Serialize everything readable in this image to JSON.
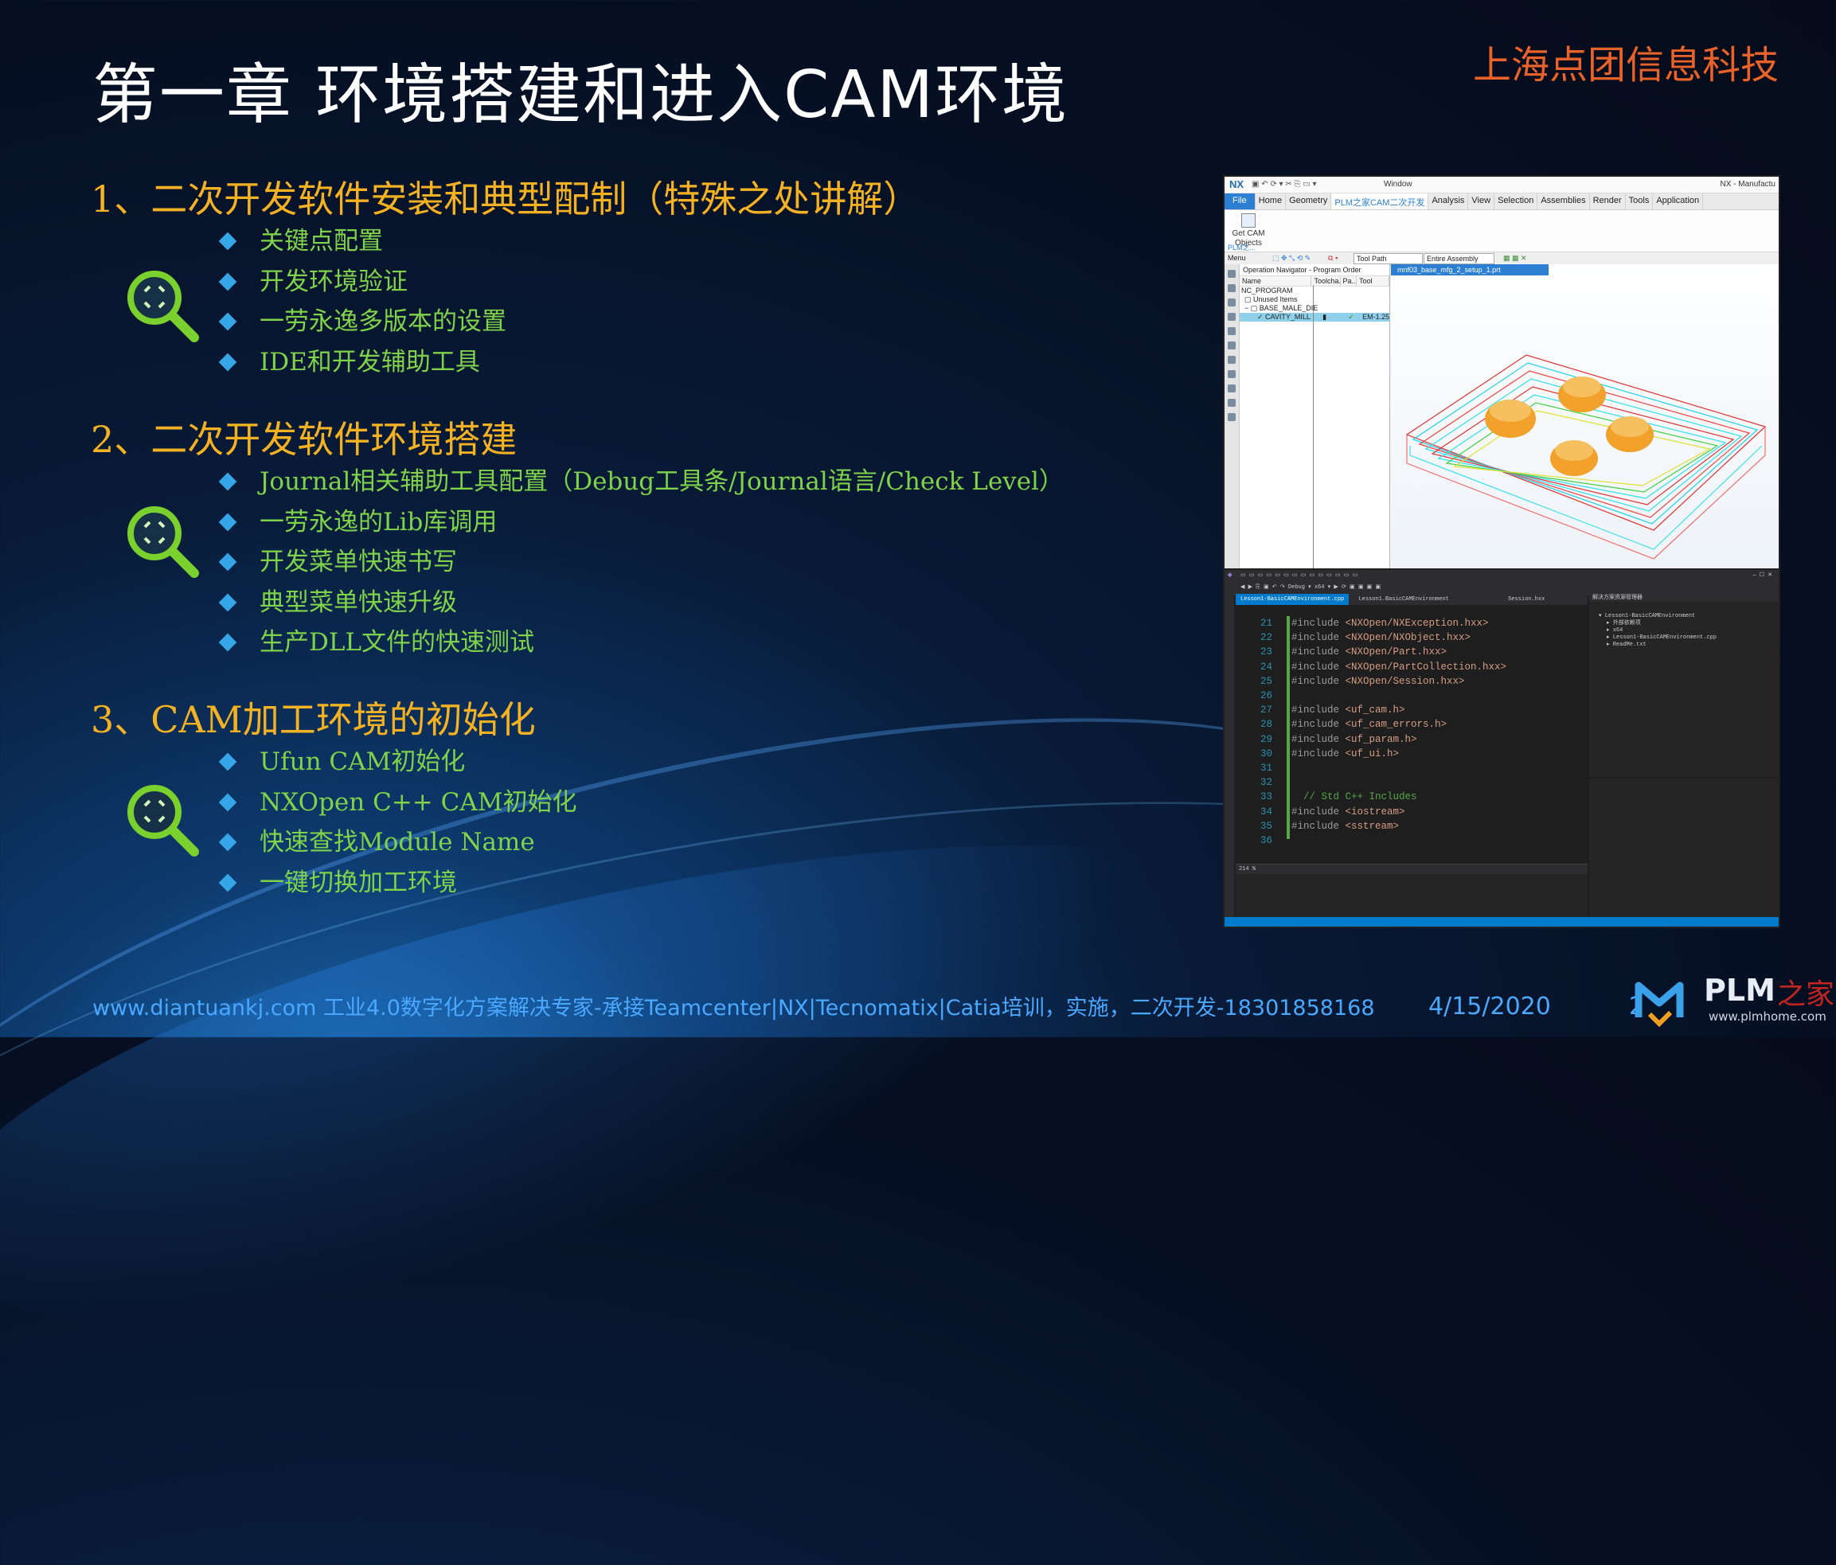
{
  "slide": {
    "title": "第一章 环境搭建和进入CAM环境",
    "brand": "上海点团信息科技",
    "sections": [
      {
        "heading": "1、二次开发软件安装和典型配制（特殊之处讲解）",
        "items": [
          "关键点配置",
          "开发环境验证",
          "一劳永逸多版本的设置",
          "IDE和开发辅助工具"
        ]
      },
      {
        "heading": "2、二次开发软件环境搭建",
        "items": [
          "Journal相关辅助工具配置（Debug工具条/Journal语言/Check Level）",
          "一劳永逸的Lib库调用",
          "开发菜单快速书写",
          "典型菜单快速升级",
          "生产DLL文件的快速测试"
        ]
      },
      {
        "heading": "3、CAM加工环境的初始化",
        "items": [
          "Ufun CAM初始化",
          "NXOpen C++ CAM初始化",
          "快速查找Module Name",
          "一键切换加工环境"
        ]
      }
    ],
    "footer": {
      "text": "www.diantuankj.com 工业4.0数字化方案解决专家-承接Teamcenter|NX|Tecnomatix|Catia培训，实施，二次开发-18301858168",
      "date": "4/15/2020",
      "page": "2"
    },
    "logo": {
      "name": "PLM",
      "cn": "之家",
      "url": "www.plmhome.com"
    },
    "colors": {
      "heading": "#f4b223",
      "bullet_text": "#7fd34a",
      "bullet_marker": "#35a6e8",
      "brand": "#e8622a",
      "footer": "#4aa8ff"
    }
  },
  "nx_screenshot": {
    "logo": "NX",
    "window_menu": "Window",
    "title": "NX - Manufactu",
    "tabs": [
      "File",
      "Home",
      "Geometry",
      "PLM之家CAM二次开发",
      "Analysis",
      "View",
      "Selection",
      "Assemblies",
      "Render",
      "Tools",
      "Application"
    ],
    "active_tab": "PLM之家CAM二次开发",
    "ribbon_button": "Get CAM Objects",
    "ribbon_group": "PLM之...",
    "menu_label": "Menu",
    "filter_combo": "Tool Path",
    "scope_combo": "Entire Assembly",
    "navigator_title": "Operation Navigator - Program Order",
    "columns": [
      "Name",
      "Toolcha...",
      "Pa...",
      "Tool"
    ],
    "rows": [
      {
        "name": "NC_PROGRAM",
        "toolchange": "",
        "path": "",
        "tool": ""
      },
      {
        "name": "Unused Items",
        "toolchange": "",
        "path": "",
        "tool": ""
      },
      {
        "name": "BASE_MALE_DIE",
        "toolchange": "",
        "path": "",
        "tool": ""
      },
      {
        "name": "CAVITY_MILL",
        "toolchange": "",
        "path": "",
        "tool": "EM-1.25..."
      }
    ],
    "doc_tab": "mnf03_base_mfg_2_setup_1.prt"
  },
  "vs_screenshot": {
    "file_tabs": [
      "Lesson1-BasicCAMEnvironment.cpp",
      "Session.hxx"
    ],
    "scope": "Lesson1.BasicCAMEnvironment",
    "code_lines": [
      {
        "n": "21",
        "text": "#include <NXOpen/NXException.hxx>"
      },
      {
        "n": "22",
        "text": "#include <NXOpen/NXObject.hxx>"
      },
      {
        "n": "23",
        "text": "#include <NXOpen/Part.hxx>"
      },
      {
        "n": "24",
        "text": "#include <NXOpen/PartCollection.hxx>"
      },
      {
        "n": "25",
        "text": "#include <NXOpen/Session.hxx>"
      },
      {
        "n": "26",
        "text": ""
      },
      {
        "n": "27",
        "text": "#include <uf_cam.h>"
      },
      {
        "n": "28",
        "text": "#include <uf_cam_errors.h>"
      },
      {
        "n": "29",
        "text": "#include <uf_param.h>"
      },
      {
        "n": "30",
        "text": "#include <uf_ui.h>"
      },
      {
        "n": "31",
        "text": ""
      },
      {
        "n": "32",
        "text": ""
      },
      {
        "n": "33",
        "text": "// Std C++ Includes"
      },
      {
        "n": "34",
        "text": "#include <iostream>"
      },
      {
        "n": "35",
        "text": "#include <sstream>"
      },
      {
        "n": "36",
        "text": ""
      }
    ],
    "zoom": "214 %",
    "debug": "Debug",
    "platform": "x64",
    "solution_title": "解决方案资源管理器",
    "solution_items": [
      "Lesson1-BasicCAMEnvironment",
      "外部依赖项",
      "x64",
      "Lesson1-BasicCAMEnvironment.cpp",
      "ReadMe.txt"
    ]
  }
}
